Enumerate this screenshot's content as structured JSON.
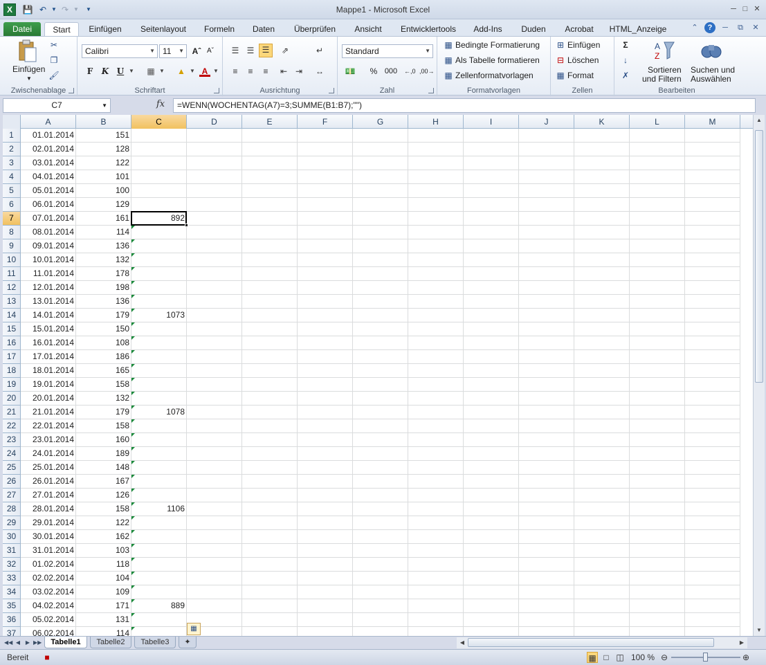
{
  "window": {
    "title": "Mappe1  -  Microsoft Excel"
  },
  "ribbon_tabs": [
    "Datei",
    "Start",
    "Einfügen",
    "Seitenlayout",
    "Formeln",
    "Daten",
    "Überprüfen",
    "Ansicht",
    "Entwicklertools",
    "Add-Ins",
    "Duden",
    "Acrobat",
    "HTML_Anzeige"
  ],
  "ribbon": {
    "clipboard": {
      "label": "Zwischenablage",
      "paste": "Einfügen"
    },
    "font": {
      "label": "Schriftart",
      "name": "Calibri",
      "size": "11",
      "bold": "F",
      "italic": "K",
      "underline": "U"
    },
    "alignment": {
      "label": "Ausrichtung"
    },
    "number": {
      "label": "Zahl",
      "format": "Standard",
      "percent": "%",
      "thousands": "000"
    },
    "styles": {
      "label": "Formatvorlagen",
      "conditional": "Bedingte Formatierung",
      "as_table": "Als Tabelle formatieren",
      "cell_styles": "Zellenformatvorlagen"
    },
    "cells": {
      "label": "Zellen",
      "insert": "Einfügen",
      "delete": "Löschen",
      "format": "Format"
    },
    "editing": {
      "label": "Bearbeiten",
      "sort_line1": "Sortieren",
      "sort_line2": "und Filtern",
      "find_line1": "Suchen und",
      "find_line2": "Auswählen"
    }
  },
  "formula_bar": {
    "name_box": "C7",
    "fx": "fx",
    "formula": "=WENN(WOCHENTAG(A7)=3;SUMME(B1:B7);\"\")"
  },
  "columns": [
    "A",
    "B",
    "C",
    "D",
    "E",
    "F",
    "G",
    "H",
    "I",
    "J",
    "K",
    "L",
    "M"
  ],
  "selected_cell": "C7",
  "rows": [
    {
      "n": "1",
      "a": "01.01.2014",
      "b": "151",
      "c": ""
    },
    {
      "n": "2",
      "a": "02.01.2014",
      "b": "128",
      "c": ""
    },
    {
      "n": "3",
      "a": "03.01.2014",
      "b": "122",
      "c": ""
    },
    {
      "n": "4",
      "a": "04.01.2014",
      "b": "101",
      "c": ""
    },
    {
      "n": "5",
      "a": "05.01.2014",
      "b": "100",
      "c": ""
    },
    {
      "n": "6",
      "a": "06.01.2014",
      "b": "129",
      "c": ""
    },
    {
      "n": "7",
      "a": "07.01.2014",
      "b": "161",
      "c": "892"
    },
    {
      "n": "8",
      "a": "08.01.2014",
      "b": "114",
      "c": ""
    },
    {
      "n": "9",
      "a": "09.01.2014",
      "b": "136",
      "c": ""
    },
    {
      "n": "10",
      "a": "10.01.2014",
      "b": "132",
      "c": ""
    },
    {
      "n": "11",
      "a": "11.01.2014",
      "b": "178",
      "c": ""
    },
    {
      "n": "12",
      "a": "12.01.2014",
      "b": "198",
      "c": ""
    },
    {
      "n": "13",
      "a": "13.01.2014",
      "b": "136",
      "c": ""
    },
    {
      "n": "14",
      "a": "14.01.2014",
      "b": "179",
      "c": "1073"
    },
    {
      "n": "15",
      "a": "15.01.2014",
      "b": "150",
      "c": ""
    },
    {
      "n": "16",
      "a": "16.01.2014",
      "b": "108",
      "c": ""
    },
    {
      "n": "17",
      "a": "17.01.2014",
      "b": "186",
      "c": ""
    },
    {
      "n": "18",
      "a": "18.01.2014",
      "b": "165",
      "c": ""
    },
    {
      "n": "19",
      "a": "19.01.2014",
      "b": "158",
      "c": ""
    },
    {
      "n": "20",
      "a": "20.01.2014",
      "b": "132",
      "c": ""
    },
    {
      "n": "21",
      "a": "21.01.2014",
      "b": "179",
      "c": "1078"
    },
    {
      "n": "22",
      "a": "22.01.2014",
      "b": "158",
      "c": ""
    },
    {
      "n": "23",
      "a": "23.01.2014",
      "b": "160",
      "c": ""
    },
    {
      "n": "24",
      "a": "24.01.2014",
      "b": "189",
      "c": ""
    },
    {
      "n": "25",
      "a": "25.01.2014",
      "b": "148",
      "c": ""
    },
    {
      "n": "26",
      "a": "26.01.2014",
      "b": "167",
      "c": ""
    },
    {
      "n": "27",
      "a": "27.01.2014",
      "b": "126",
      "c": ""
    },
    {
      "n": "28",
      "a": "28.01.2014",
      "b": "158",
      "c": "1106"
    },
    {
      "n": "29",
      "a": "29.01.2014",
      "b": "122",
      "c": ""
    },
    {
      "n": "30",
      "a": "30.01.2014",
      "b": "162",
      "c": ""
    },
    {
      "n": "31",
      "a": "31.01.2014",
      "b": "103",
      "c": ""
    },
    {
      "n": "32",
      "a": "01.02.2014",
      "b": "118",
      "c": ""
    },
    {
      "n": "33",
      "a": "02.02.2014",
      "b": "104",
      "c": ""
    },
    {
      "n": "34",
      "a": "03.02.2014",
      "b": "109",
      "c": ""
    },
    {
      "n": "35",
      "a": "04.02.2014",
      "b": "171",
      "c": "889"
    },
    {
      "n": "36",
      "a": "05.02.2014",
      "b": "131",
      "c": ""
    },
    {
      "n": "37",
      "a": "06.02.2014",
      "b": "114",
      "c": ""
    }
  ],
  "sheet_tabs": [
    "Tabelle1",
    "Tabelle2",
    "Tabelle3"
  ],
  "active_sheet": "Tabelle1",
  "status": {
    "mode": "Bereit",
    "zoom": "100 %"
  },
  "colors": {
    "file_tab": "#2b7a35",
    "selection_header": "#f1c15f",
    "error_indicator": "#1a8a3a"
  }
}
